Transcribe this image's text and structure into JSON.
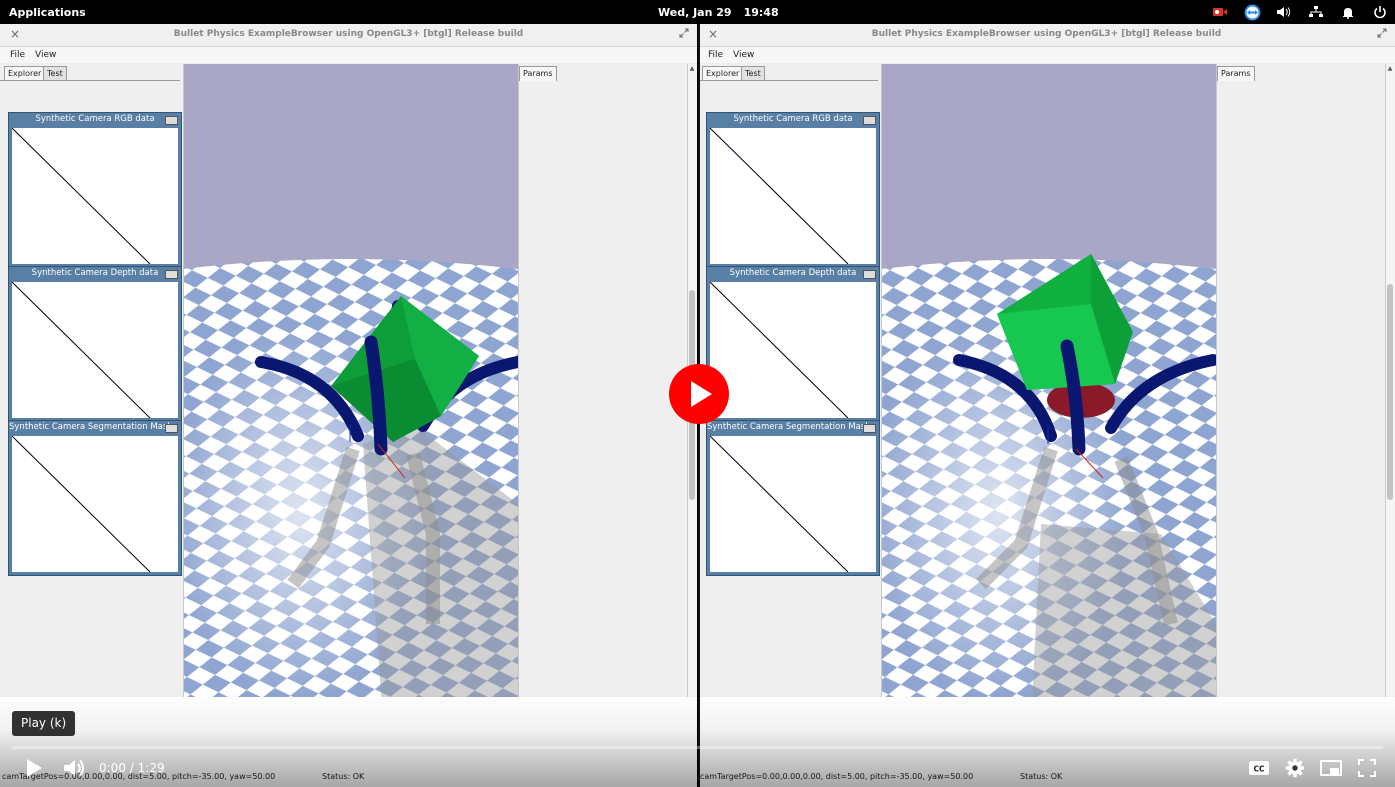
{
  "topbar": {
    "applications_label": "Applications",
    "date": "Wed, Jan 29",
    "time": "19:48",
    "tray_icons": [
      "camera-recording-icon",
      "teamviewer-icon",
      "volume-icon",
      "network-icon",
      "notification-bell-icon",
      "power-icon"
    ]
  },
  "windows": [
    {
      "title": "Bullet Physics ExampleBrowser using OpenGL3+ [btgl] Release build",
      "close": "×",
      "menu": [
        "File",
        "View"
      ],
      "tabs": [
        "Explorer",
        "Test"
      ],
      "camera_panels": [
        "Synthetic Camera RGB data",
        "Synthetic Camera Depth data",
        "Synthetic Camera Segmentation Mask"
      ],
      "params_tab": "Params",
      "status_pos": "camTargetPos=0.00,0.00,0.00, dist=5.00, pitch=-35.00, yaw=50.00",
      "status": "Status: OK"
    },
    {
      "title": "Bullet Physics ExampleBrowser using OpenGL3+ [btgl] Release build",
      "close": "×",
      "menu": [
        "File",
        "View"
      ],
      "tabs": [
        "Explorer",
        "Test"
      ],
      "camera_panels": [
        "Synthetic Camera RGB data",
        "Synthetic Camera Depth data",
        "Synthetic Camera Segmentation Mask"
      ],
      "params_tab": "Params",
      "status_pos": "camTargetPos=0.00,0.00,0.00, dist=5.00, pitch=-35.00, yaw=50.00",
      "status": "Status: OK"
    }
  ],
  "video": {
    "tooltip": "Play (k)",
    "current_time": "0:00",
    "separator": "/",
    "duration": "1:29",
    "progress": 0,
    "colors": {
      "play_button": "#ff0000",
      "cube": "#10b040",
      "legs": "#0a1770",
      "sky": "#a9a6c6"
    }
  }
}
